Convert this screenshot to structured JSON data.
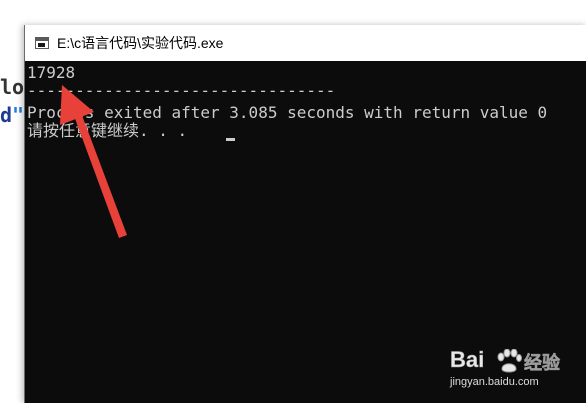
{
  "background_editor": {
    "line1": "lo",
    "line2_word": "d",
    "line2_quote": "\""
  },
  "window": {
    "title": "E:\\c语言代码\\实验代码.exe",
    "icon": "console-window-icon"
  },
  "console": {
    "output_value": "17928",
    "separator": "--------------------------------",
    "process_message": "Process exited after 3.085 seconds with return value 0",
    "continue_prompt": "请按任意键继续. . . "
  },
  "annotation": {
    "arrow_color": "#e8413a",
    "arrow_icon": "red-arrow-annotation"
  },
  "watermark": {
    "brand": "Bai",
    "brand_suffix": "经验",
    "url": "jingyan.baidu.com"
  },
  "colors": {
    "console_bg": "#0c0c0c",
    "console_text": "#cccccc",
    "titlebar_bg": "#ffffff"
  }
}
